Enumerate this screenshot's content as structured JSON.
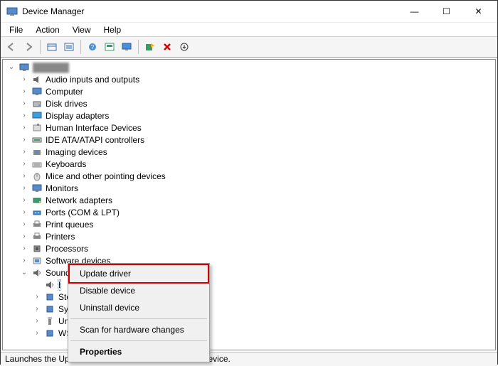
{
  "window": {
    "title": "Device Manager",
    "minimize": "—",
    "maximize": "☐",
    "close": "✕"
  },
  "menu": [
    "File",
    "Action",
    "View",
    "Help"
  ],
  "tree": {
    "root": {
      "label": "",
      "expanded": true
    },
    "children": [
      {
        "label": "Audio inputs and outputs",
        "expanded": false,
        "icon": "speaker"
      },
      {
        "label": "Computer",
        "expanded": false,
        "icon": "monitor"
      },
      {
        "label": "Disk drives",
        "expanded": false,
        "icon": "disk"
      },
      {
        "label": "Display adapters",
        "expanded": false,
        "icon": "display"
      },
      {
        "label": "Human Interface Devices",
        "expanded": false,
        "icon": "hid"
      },
      {
        "label": "IDE ATA/ATAPI controllers",
        "expanded": false,
        "icon": "ide"
      },
      {
        "label": "Imaging devices",
        "expanded": false,
        "icon": "camera"
      },
      {
        "label": "Keyboards",
        "expanded": false,
        "icon": "keyboard"
      },
      {
        "label": "Mice and other pointing devices",
        "expanded": false,
        "icon": "mouse"
      },
      {
        "label": "Monitors",
        "expanded": false,
        "icon": "monitor2"
      },
      {
        "label": "Network adapters",
        "expanded": false,
        "icon": "network"
      },
      {
        "label": "Ports (COM & LPT)",
        "expanded": false,
        "icon": "port"
      },
      {
        "label": "Print queues",
        "expanded": false,
        "icon": "printq"
      },
      {
        "label": "Printers",
        "expanded": false,
        "icon": "printer"
      },
      {
        "label": "Processors",
        "expanded": false,
        "icon": "cpu"
      },
      {
        "label": "Software devices",
        "expanded": false,
        "icon": "soft"
      },
      {
        "label": "Sound, video and game controllers",
        "expanded": true,
        "icon": "sound",
        "children": [
          {
            "label_prefix": "I",
            "selected_hidden": true
          },
          {
            "label_prefix": "Stor"
          },
          {
            "label_prefix": "Syst"
          },
          {
            "label_prefix": "Univ"
          },
          {
            "label_prefix": "WSD"
          }
        ]
      }
    ]
  },
  "context_menu": {
    "items": [
      {
        "id": "update",
        "label": "Update driver",
        "highlight": true
      },
      {
        "id": "disable",
        "label": "Disable device"
      },
      {
        "id": "uninstall",
        "label": "Uninstall device"
      },
      {
        "sep": true
      },
      {
        "id": "scan",
        "label": "Scan for hardware changes"
      },
      {
        "sep": true
      },
      {
        "id": "props",
        "label": "Properties",
        "bold": true
      }
    ]
  },
  "statusbar": "Launches the Update Driver Wizard for the selected device."
}
